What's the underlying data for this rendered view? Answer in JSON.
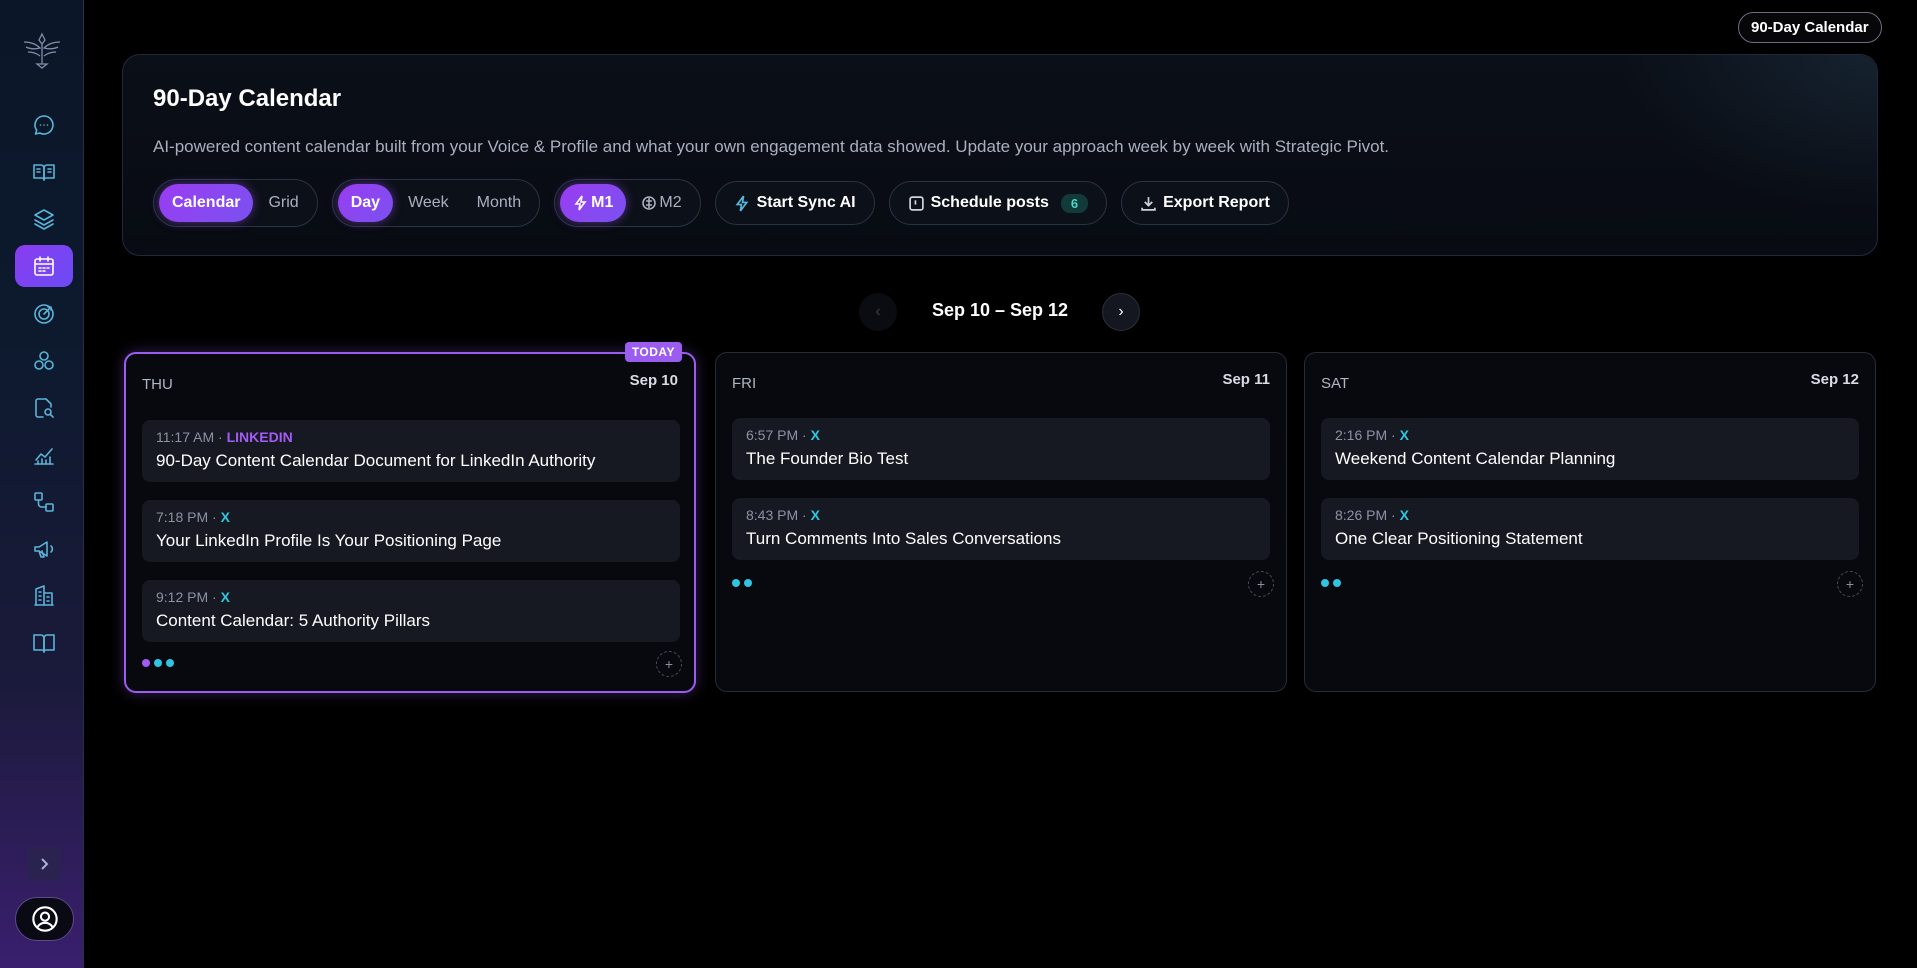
{
  "top_badge": "90-Day Calendar",
  "header": {
    "title": "90-Day Calendar",
    "description": "AI-powered content calendar built from your Voice & Profile and what your own engagement data showed. Update your approach week by week with Strategic Pivot."
  },
  "view_toggle": {
    "calendar": "Calendar",
    "grid": "Grid"
  },
  "range_toggle": {
    "day": "Day",
    "week": "Week",
    "month": "Month"
  },
  "mode_toggle": {
    "m1": "M1",
    "m2": "M2"
  },
  "buttons": {
    "sync": "Start Sync AI",
    "schedule": "Schedule posts",
    "schedule_count": "6",
    "export": "Export Report"
  },
  "date_nav": {
    "prev": "‹",
    "next": "›",
    "range": "Sep 10 – Sep 12"
  },
  "days": [
    {
      "name": "THU",
      "date": "Sep 10",
      "today": true,
      "today_label": "TODAY",
      "posts": [
        {
          "time": "11:17 AM",
          "platform": "LINKEDIN",
          "title": "90-Day Content Calendar Document for LinkedIn Authority"
        },
        {
          "time": "7:18 PM",
          "platform": "X",
          "title": "Your LinkedIn Profile Is Your Positioning Page"
        },
        {
          "time": "9:12 PM",
          "platform": "X",
          "title": "Content Calendar: 5 Authority Pillars"
        }
      ]
    },
    {
      "name": "FRI",
      "date": "Sep 11",
      "today": false,
      "posts": [
        {
          "time": "6:57 PM",
          "platform": "X",
          "title": "The Founder Bio Test"
        },
        {
          "time": "8:43 PM",
          "platform": "X",
          "title": "Turn Comments Into Sales Conversations"
        }
      ]
    },
    {
      "name": "SAT",
      "date": "Sep 12",
      "today": false,
      "posts": [
        {
          "time": "2:16 PM",
          "platform": "X",
          "title": "Weekend Content Calendar Planning"
        },
        {
          "time": "8:26 PM",
          "platform": "X",
          "title": "One Clear Positioning Statement"
        }
      ]
    }
  ],
  "add_label": "+",
  "colors": {
    "accent": "#9b5cf0",
    "x_platform": "#2fc5e0",
    "linkedin_platform": "#a25cf5"
  }
}
